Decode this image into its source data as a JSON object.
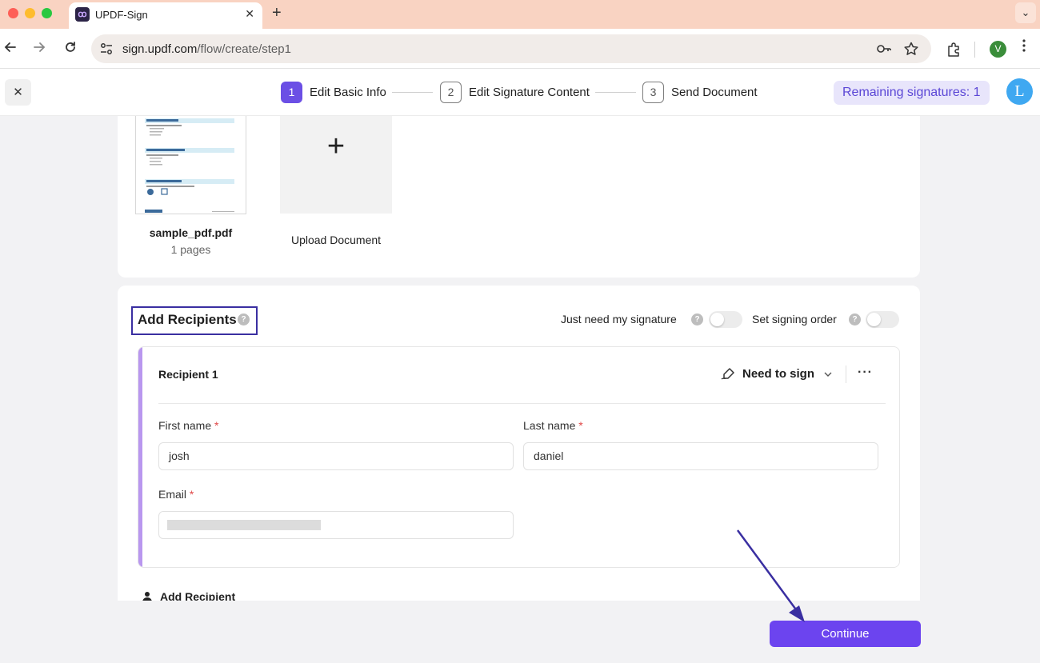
{
  "browser": {
    "tab_title": "UPDF-Sign",
    "tab_close": "✕",
    "new_tab": "+",
    "tab_menu": "⌄",
    "url_host": "sign.updf.com",
    "url_path": "/flow/create/step1",
    "profile_initial": "V",
    "icons": [
      "back-icon",
      "forward-icon",
      "reload-icon",
      "site-settings-icon",
      "password-key-icon",
      "bookmark-star-icon",
      "extensions-icon",
      "kebab-menu-icon"
    ]
  },
  "header": {
    "close": "✕",
    "steps": [
      {
        "num": "1",
        "label": "Edit Basic Info",
        "active": true
      },
      {
        "num": "2",
        "label": "Edit Signature Content",
        "active": false
      },
      {
        "num": "3",
        "label": "Send Document",
        "active": false
      }
    ],
    "remaining": "Remaining signatures: 1",
    "avatar_initial": "L"
  },
  "documents": {
    "file_name": "sample_pdf.pdf",
    "file_pages": "1 pages",
    "upload_label": "Upload Document",
    "upload_plus": "+"
  },
  "recipients": {
    "title": "Add Recipients",
    "help": "?",
    "just_me_label": "Just need my signature",
    "just_me_on": false,
    "signing_order_label": "Set signing order",
    "signing_order_on": false,
    "recipient": {
      "name": "Recipient 1",
      "role": "Need to sign",
      "more": "···",
      "first_name_label": "First name",
      "first_name_value": "josh",
      "last_name_label": "Last name",
      "last_name_value": "daniel",
      "email_label": "Email",
      "required_mark": "*"
    },
    "add_label": "Add Recipient"
  },
  "footer": {
    "continue_label": "Continue"
  },
  "colors": {
    "accent": "#6c44ef",
    "annotation": "#3a2fa1",
    "recipient_accent": "#b997ef"
  }
}
